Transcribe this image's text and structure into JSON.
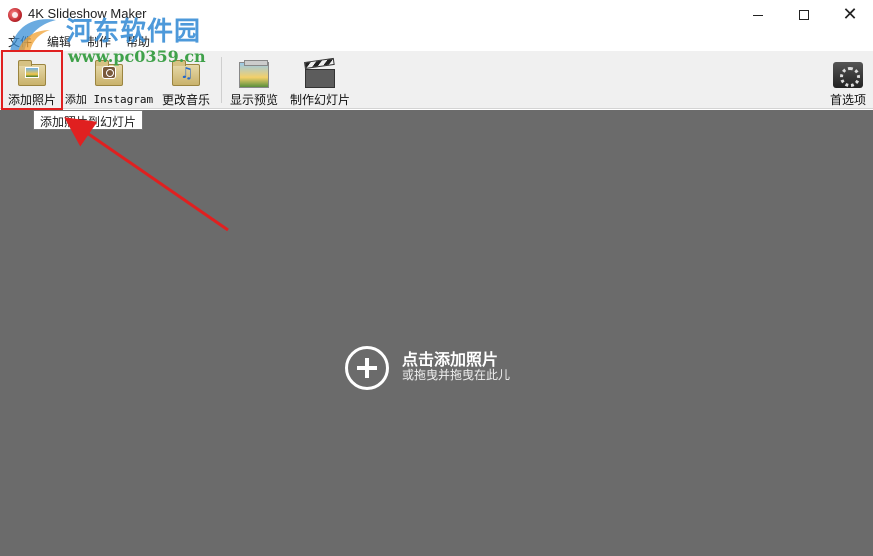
{
  "window": {
    "title": "4K Slideshow Maker",
    "minimize_glyph": "",
    "maximize_glyph": "",
    "close_glyph": "✕"
  },
  "menu": {
    "file": "文件",
    "edit": "编辑",
    "make": "制作",
    "help": "帮助"
  },
  "watermark": {
    "title": "河东软件园",
    "url": "www.pc0359.cn"
  },
  "toolbar": {
    "add_photos": "添加照片",
    "add_instagram": "添加 Instagram",
    "change_music": "更改音乐",
    "show_preview": "显示预览",
    "make_slideshow": "制作幻灯片",
    "preferences": "首选项"
  },
  "tooltip": {
    "text": "添加照片到幻灯片"
  },
  "main": {
    "title": "点击添加照片",
    "subtitle": "或拖曳并拖曳在此儿"
  },
  "colors": {
    "main_bg": "#6b6b6b",
    "toolbar_bg": "#f0f0f0",
    "highlight": "#e02020",
    "arrow": "#e02020"
  },
  "icons": {
    "app": "app-icon",
    "add_photos": "folder-photo-icon",
    "add_instagram": "folder-instagram-icon",
    "change_music": "folder-music-icon",
    "show_preview": "preview-icon",
    "make_slideshow": "clapperboard-icon",
    "preferences": "gear-icon",
    "add": "plus-circle-icon"
  }
}
